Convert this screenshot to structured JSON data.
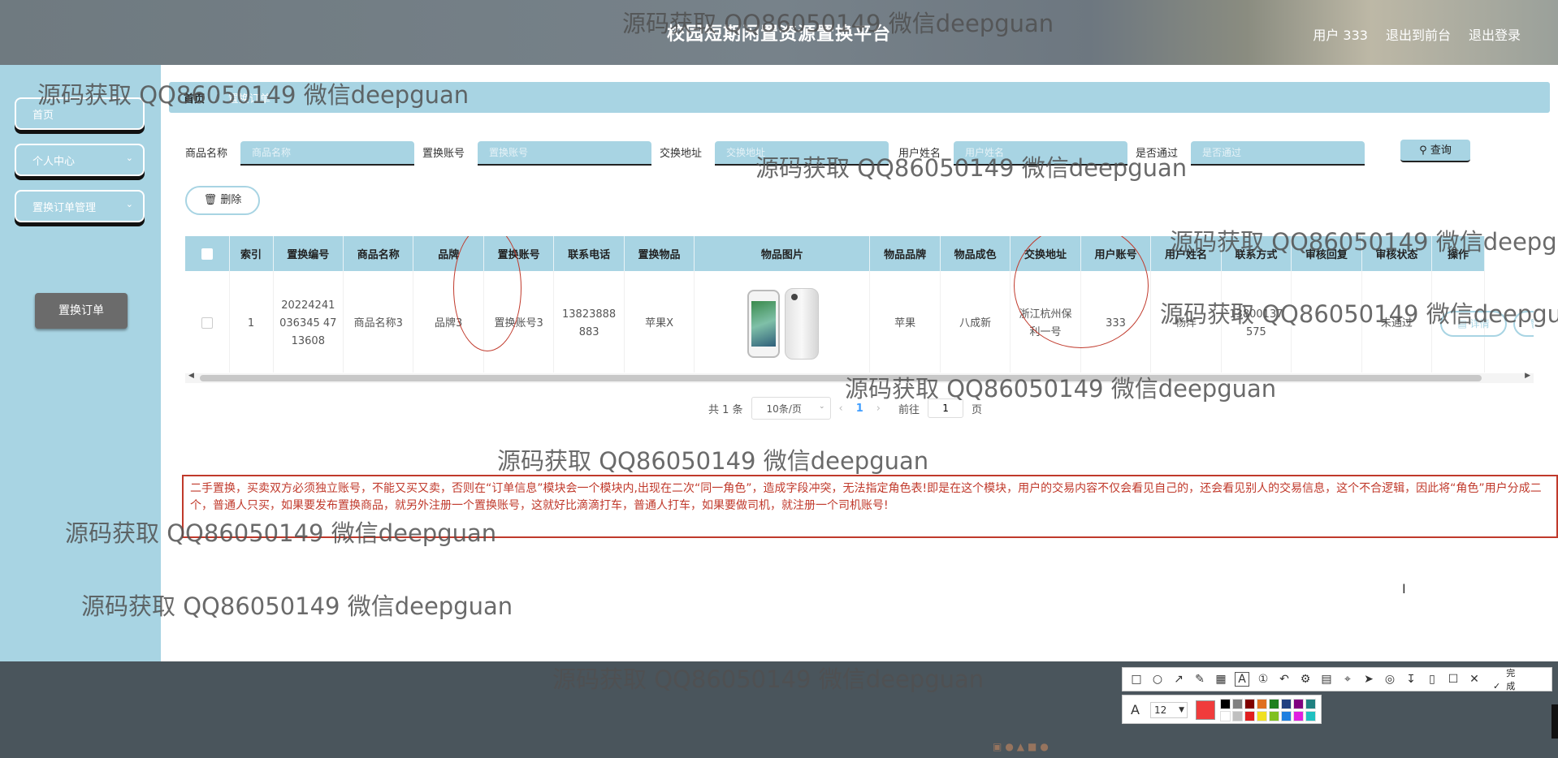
{
  "header": {
    "title": "校园短期闲置资源置换平台",
    "nav": [
      "用户 333",
      "退出到前台",
      "退出登录"
    ]
  },
  "sidebar": {
    "items": [
      {
        "label": "首页"
      },
      {
        "label": "个人中心"
      },
      {
        "label": "置换订单管理"
      }
    ],
    "submenu": {
      "label": "置换订单"
    }
  },
  "breadcrumb": {
    "home": "首页",
    "current": "置换订单"
  },
  "search": {
    "fields": [
      {
        "label": "商品名称",
        "placeholder": "商品名称"
      },
      {
        "label": "置换账号",
        "placeholder": "置换账号"
      },
      {
        "label": "交换地址",
        "placeholder": "交换地址"
      },
      {
        "label": "用户姓名",
        "placeholder": "用户姓名"
      },
      {
        "label": "是否通过",
        "placeholder": "是否通过"
      }
    ],
    "query_label": "查询",
    "query_icon": "search-icon"
  },
  "actions": {
    "delete_label": "删除",
    "delete_icon": "trash-icon"
  },
  "table": {
    "headers": [
      "索引",
      "置换编号",
      "商品名称",
      "品牌",
      "置换账号",
      "联系电话",
      "置换物品",
      "物品图片",
      "物品品牌",
      "物品成色",
      "交换地址",
      "用户账号",
      "用户姓名",
      "联系方式",
      "审核回复",
      "审核状态",
      "操作"
    ],
    "rows": [
      {
        "index": "1",
        "order_no": "20224241036345 4713608",
        "product_name": "商品名称3",
        "brand": "品牌3",
        "swap_account": "置换账号3",
        "phone": "13823888883",
        "swap_item": "苹果X",
        "image": "iphone-image",
        "item_brand": "苹果",
        "condition": "八成新",
        "address": "浙江杭州保利一号",
        "user_account": "333",
        "user_name": "杨洋",
        "contact": "13800137575",
        "review_reply": "",
        "review_status": "未通过",
        "detail_label": "详情",
        "delete_label": "删除"
      }
    ]
  },
  "pagination": {
    "total": "共 1 条",
    "page_size": "10条/页",
    "current_page": "1",
    "goto_prefix": "前往",
    "goto_value": "1",
    "goto_suffix": "页"
  },
  "note": {
    "text": "二手置换，买卖双方必须独立账号，不能又买又卖，否则在“订单信息”模块会一个模块内,出现在二次“同一角色”，造成字段冲突，无法指定角色表!即是在这个模块，用户的交易内容不仅会看见自己的，还会看见别人的交易信息，这个不合逻辑，因此将“角色”用户分成二个，普通人只买，如果要发布置换商品，就另外注册一个置换账号，这就好比滴滴打车，普通人打车，如果要做司机，就注册一个司机账号!"
  },
  "screenshot_tool": {
    "done_label": "完成",
    "font_size": "12",
    "current_color": "#f03c3c",
    "palette": [
      "#000000",
      "#808080",
      "#800000",
      "#e07020",
      "#208020",
      "#204080",
      "#800080",
      "#208080",
      "#ffffff",
      "#c0c0c0",
      "#e02020",
      "#f0e020",
      "#80c020",
      "#2080e0",
      "#e020e0",
      "#20c0c0"
    ]
  },
  "watermark": "源码获取 QQ86050149 微信deepguan",
  "colors": {
    "accent": "#a8d4e3",
    "annotation": "#c0392b",
    "page_active": "#409eff"
  }
}
